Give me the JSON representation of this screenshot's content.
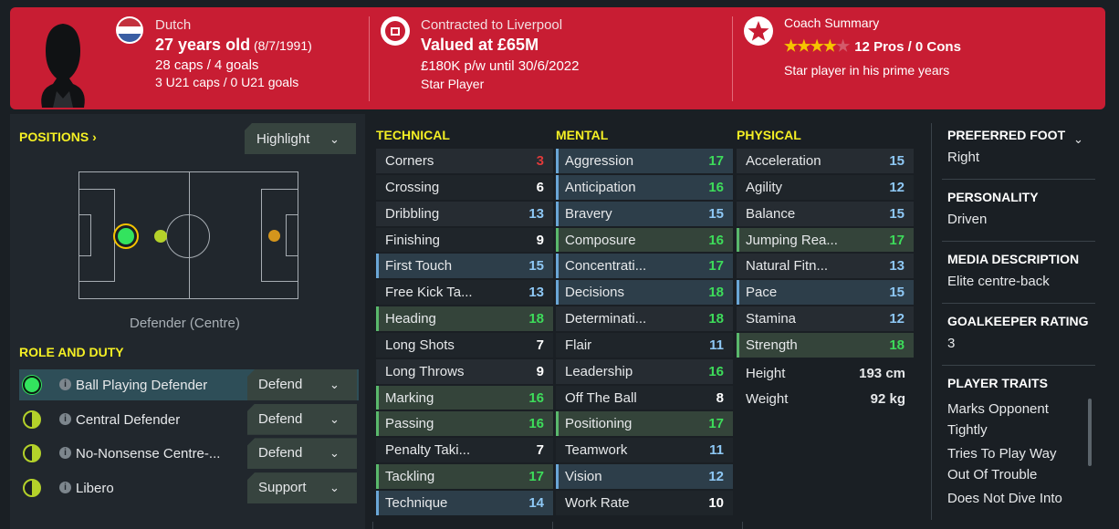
{
  "header": {
    "nationality": "Dutch",
    "age": "27 years old",
    "dob": "(8/7/1991)",
    "caps": "28 caps / 4 goals",
    "u21": "3 U21 caps / 0 U21 goals",
    "contract": "Contracted to Liverpool",
    "value": "Valued at £65M",
    "wage": "£180K p/w until 30/6/2022",
    "status": "Star Player",
    "coach_title": "Coach Summary",
    "pros_cons": "12 Pros / 0 Cons",
    "coach_note": "Star player in his prime years",
    "star_rating": 4.5
  },
  "positions": {
    "title": "POSITIONS",
    "arrow": "›",
    "highlight_label": "Highlight",
    "position_label": "Defender (Centre)"
  },
  "role_duty": {
    "title": "ROLE AND DUTY",
    "items": [
      {
        "role": "Ball Playing Defender",
        "duty": "Defend",
        "selected": true
      },
      {
        "role": "Central Defender",
        "duty": "Defend",
        "selected": false
      },
      {
        "role": "No-Nonsense Centre-...",
        "duty": "Defend",
        "selected": false
      },
      {
        "role": "Libero",
        "duty": "Support",
        "selected": false
      }
    ]
  },
  "technical": {
    "title": "TECHNICAL",
    "attrs": [
      {
        "name": "Corners",
        "value": "3",
        "hl": ""
      },
      {
        "name": "Crossing",
        "value": "6",
        "hl": ""
      },
      {
        "name": "Dribbling",
        "value": "13",
        "hl": ""
      },
      {
        "name": "Finishing",
        "value": "9",
        "hl": ""
      },
      {
        "name": "First Touch",
        "value": "15",
        "hl": "blue"
      },
      {
        "name": "Free Kick Ta...",
        "value": "13",
        "hl": ""
      },
      {
        "name": "Heading",
        "value": "18",
        "hl": "green"
      },
      {
        "name": "Long Shots",
        "value": "7",
        "hl": ""
      },
      {
        "name": "Long Throws",
        "value": "9",
        "hl": ""
      },
      {
        "name": "Marking",
        "value": "16",
        "hl": "green"
      },
      {
        "name": "Passing",
        "value": "16",
        "hl": "green"
      },
      {
        "name": "Penalty Taki...",
        "value": "7",
        "hl": ""
      },
      {
        "name": "Tackling",
        "value": "17",
        "hl": "green"
      },
      {
        "name": "Technique",
        "value": "14",
        "hl": "blue"
      }
    ]
  },
  "mental": {
    "title": "MENTAL",
    "attrs": [
      {
        "name": "Aggression",
        "value": "17",
        "hl": "blue"
      },
      {
        "name": "Anticipation",
        "value": "16",
        "hl": "blue"
      },
      {
        "name": "Bravery",
        "value": "15",
        "hl": "blue"
      },
      {
        "name": "Composure",
        "value": "16",
        "hl": "green"
      },
      {
        "name": "Concentrati...",
        "value": "17",
        "hl": "blue"
      },
      {
        "name": "Decisions",
        "value": "18",
        "hl": "blue"
      },
      {
        "name": "Determinati...",
        "value": "18",
        "hl": ""
      },
      {
        "name": "Flair",
        "value": "11",
        "hl": ""
      },
      {
        "name": "Leadership",
        "value": "16",
        "hl": ""
      },
      {
        "name": "Off The Ball",
        "value": "8",
        "hl": ""
      },
      {
        "name": "Positioning",
        "value": "17",
        "hl": "green"
      },
      {
        "name": "Teamwork",
        "value": "11",
        "hl": ""
      },
      {
        "name": "Vision",
        "value": "12",
        "hl": "blue"
      },
      {
        "name": "Work Rate",
        "value": "10",
        "hl": ""
      }
    ]
  },
  "physical": {
    "title": "PHYSICAL",
    "attrs": [
      {
        "name": "Acceleration",
        "value": "15",
        "hl": ""
      },
      {
        "name": "Agility",
        "value": "12",
        "hl": ""
      },
      {
        "name": "Balance",
        "value": "15",
        "hl": ""
      },
      {
        "name": "Jumping Rea...",
        "value": "17",
        "hl": "green"
      },
      {
        "name": "Natural Fitn...",
        "value": "13",
        "hl": ""
      },
      {
        "name": "Pace",
        "value": "15",
        "hl": "blue"
      },
      {
        "name": "Stamina",
        "value": "12",
        "hl": ""
      },
      {
        "name": "Strength",
        "value": "18",
        "hl": "green"
      }
    ],
    "height_label": "Height",
    "height": "193 cm",
    "weight_label": "Weight",
    "weight": "92 kg"
  },
  "info": {
    "preferred_foot_h": "PREFERRED FOOT",
    "preferred_foot": "Right",
    "personality_h": "PERSONALITY",
    "personality": "Driven",
    "media_h": "MEDIA DESCRIPTION",
    "media": "Elite centre-back",
    "gk_h": "GOALKEEPER RATING",
    "gk": "3",
    "traits_h": "PLAYER TRAITS",
    "traits": [
      "Marks Opponent",
      "Tightly",
      "Tries To Play Way",
      "Out Of Trouble",
      "Does Not Dive Into"
    ]
  },
  "colors": {
    "header_red": "#c81d33",
    "highlight_yellow": "#f4ef24",
    "green_value": "#3ddc5a",
    "blue_value": "#8ec8f5",
    "red_value": "#e03a3a"
  }
}
